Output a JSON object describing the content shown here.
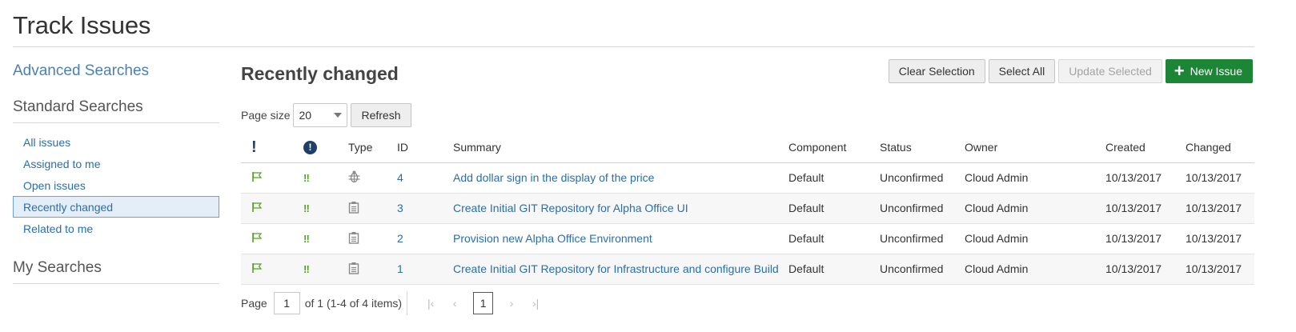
{
  "page": {
    "title": "Track Issues"
  },
  "sidebar": {
    "advanced_link": "Advanced Searches",
    "standard_heading": "Standard Searches",
    "items": [
      {
        "label": "All issues",
        "active": false
      },
      {
        "label": "Assigned to me",
        "active": false
      },
      {
        "label": "Open issues",
        "active": false
      },
      {
        "label": "Recently changed",
        "active": true
      },
      {
        "label": "Related to me",
        "active": false
      }
    ],
    "my_heading": "My Searches"
  },
  "main": {
    "title": "Recently changed",
    "toolbar": {
      "clear_selection": "Clear Selection",
      "select_all": "Select All",
      "update_selected": "Update Selected",
      "new_issue": "New Issue"
    },
    "page_size": {
      "label": "Page size",
      "value": "20",
      "refresh": "Refresh"
    },
    "table": {
      "headers": {
        "priority": "!",
        "severity": "!",
        "type": "Type",
        "id": "ID",
        "summary": "Summary",
        "component": "Component",
        "status": "Status",
        "owner": "Owner",
        "created": "Created",
        "changed": "Changed"
      },
      "rows": [
        {
          "type_icon": "bug-icon",
          "id": "4",
          "summary": "Add dollar sign in the display of the price",
          "component": "Default",
          "status": "Unconfirmed",
          "owner": "Cloud Admin",
          "created": "10/13/2017",
          "changed": "10/13/2017"
        },
        {
          "type_icon": "task-icon",
          "id": "3",
          "summary": "Create Initial GIT Repository for Alpha Office UI",
          "component": "Default",
          "status": "Unconfirmed",
          "owner": "Cloud Admin",
          "created": "10/13/2017",
          "changed": "10/13/2017"
        },
        {
          "type_icon": "task-icon",
          "id": "2",
          "summary": "Provision new Alpha Office Environment",
          "component": "Default",
          "status": "Unconfirmed",
          "owner": "Cloud Admin",
          "created": "10/13/2017",
          "changed": "10/13/2017"
        },
        {
          "type_icon": "task-icon",
          "id": "1",
          "summary": "Create Initial GIT Repository for Infrastructure and configure Build",
          "component": "Default",
          "status": "Unconfirmed",
          "owner": "Cloud Admin",
          "created": "10/13/2017",
          "changed": "10/13/2017"
        }
      ],
      "severity_glyph": "‼"
    },
    "pager": {
      "label": "Page",
      "page_value": "1",
      "of_text": "of 1 (1-4 of 4 items)",
      "current": "1"
    }
  },
  "colors": {
    "accent": "#2a6eab",
    "primary_button": "#1d8536",
    "severity": "#57a024"
  }
}
